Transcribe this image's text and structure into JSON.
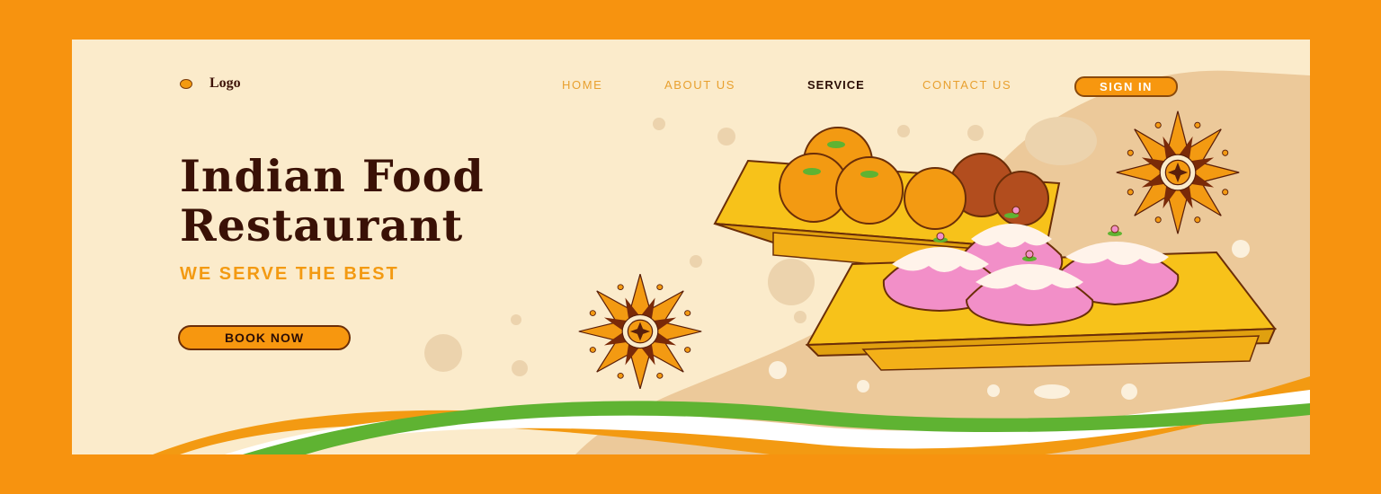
{
  "nav": {
    "logo": "Logo",
    "links": [
      "HOME",
      "ABOUT US",
      "SERVICE",
      "CONTACT US"
    ],
    "active": "SERVICE",
    "signin": "SIGN IN"
  },
  "hero": {
    "title_line1": "Indian Food",
    "title_line2": "Restaurant",
    "tagline": "WE SERVE THE BEST",
    "cta": "BOOK NOW"
  },
  "colors": {
    "frame": "#f7930f",
    "background": "#fbebcb",
    "accent": "#f7970f",
    "title": "#3a1106",
    "tricolor_saffron": "#f39a12",
    "tricolor_green": "#5fb332"
  },
  "icons": [
    "logo-dot-icon",
    "rangoli-icon",
    "ladoo-plate",
    "modak-plate"
  ]
}
